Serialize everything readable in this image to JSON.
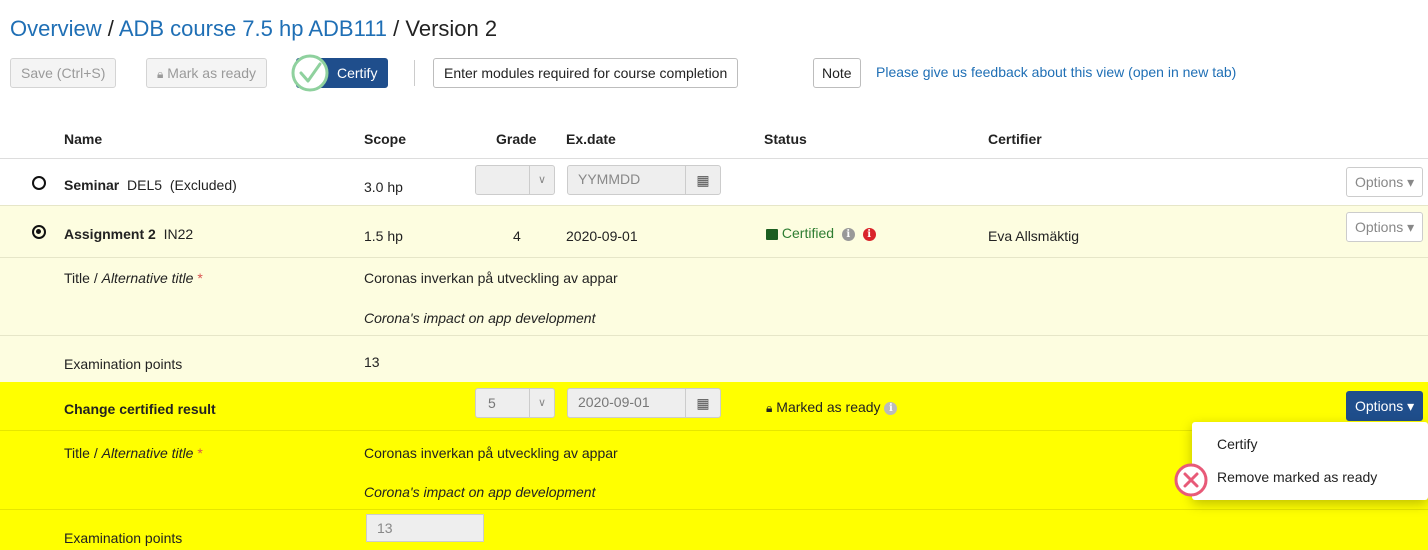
{
  "header": {
    "breadcrumb_overview": "Overview",
    "breadcrumb_sep1": " / ",
    "breadcrumb_course": "ADB course 7.5 hp ADB111",
    "breadcrumb_sep2": " / ",
    "breadcrumb_version": "Version 2"
  },
  "toolbar": {
    "save_label": "Save (Ctrl+S)",
    "mark_ready_label": "Mark as ready",
    "certify_label": "Certify",
    "modules_label": "Enter modules required for course completion",
    "note_label": "Note",
    "feedback_link": "Please give us feedback about this view (open in new tab)"
  },
  "table": {
    "headers": {
      "name": "Name",
      "scope": "Scope",
      "grade": "Grade",
      "exdate": "Ex.date",
      "status": "Status",
      "certifier": "Certifier"
    },
    "row_seminar": {
      "name": "Seminar",
      "code": "DEL5",
      "note": "(Excluded)",
      "scope": "3.0 hp",
      "grade": "",
      "date_placeholder": "YYMMDD",
      "options": "Options"
    },
    "row_assignment": {
      "name": "Assignment 2",
      "code": "IN22",
      "scope": "1.5 hp",
      "grade": "4",
      "date": "2020-09-01",
      "status": "Certified",
      "certifier": "Eva Allsmäktig",
      "options": "Options"
    },
    "assignment_details": {
      "title_label": "Title / ",
      "alt_title_label": "Alternative title",
      "required_mark": " *",
      "title": "Coronas inverkan på utveckling av appar",
      "alt_title": "Corona's impact on app development",
      "points_label": "Examination points",
      "points": "13"
    },
    "change_row": {
      "label": "Change certified result",
      "grade": "5",
      "date": "2020-09-01",
      "status": "Marked as ready",
      "options": "Options"
    },
    "change_details": {
      "title_label": "Title / ",
      "alt_title_label": "Alternative title",
      "required_mark": " *",
      "title": "Coronas inverkan på utveckling av appar",
      "alt_title": "Corona's impact on app development",
      "points_label": "Examination points",
      "points": "13"
    }
  },
  "options_menu": {
    "items": [
      "Certify",
      "Remove marked as ready"
    ]
  },
  "colors": {
    "link": "#1f6fb5",
    "primary": "#1f4e8c",
    "row_light_yellow": "#fdfde0",
    "row_yellow": "#ffff00",
    "certified_green": "#2e7d32",
    "highlight_green_circle": "#8fd19e",
    "highlight_red_circle": "#e85a78"
  }
}
